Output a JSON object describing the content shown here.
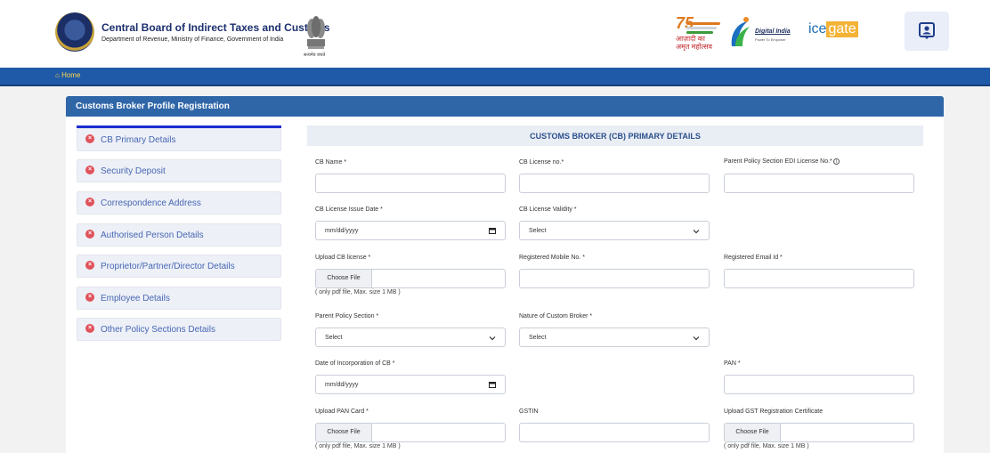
{
  "header": {
    "org_title": "Central Board of Indirect Taxes and Customs",
    "org_subtitle": "Department of Revenue, Ministry of Finance, Government of India",
    "emblem_caption": "सत्यमेव जयते",
    "azadi_number": "75",
    "azadi_hindi_1": "आज़ादी का",
    "azadi_hindi_2": "अमृत महोत्सव",
    "digital_india": "Digital India",
    "digital_india_tag": "Power To Empower",
    "icegate_left": "ice",
    "icegate_right": "gate"
  },
  "nav": {
    "home": "Home"
  },
  "panel": {
    "title": "Customs Broker Profile Registration"
  },
  "tabs": [
    {
      "label": "CB Primary Details"
    },
    {
      "label": "Security Deposit"
    },
    {
      "label": "Correspondence Address"
    },
    {
      "label": "Authorised Person Details"
    },
    {
      "label": "Proprietor/Partner/Director Details"
    },
    {
      "label": "Employee Details"
    },
    {
      "label": "Other Policy Sections Details"
    }
  ],
  "form": {
    "section_title": "CUSTOMS BROKER (CB) PRIMARY DETAILS",
    "cb_name": "CB Name *",
    "cb_license_no": "CB License no.*",
    "parent_edi": "Parent Policy Section EDI License No.*",
    "issue_date": "CB License Issue Date *",
    "license_validity": "CB License Validity *",
    "upload_cb_license": "Upload CB license *",
    "reg_mobile": "Registered Mobile No. *",
    "reg_email": "Registered Email Id *",
    "parent_policy": "Parent Policy Section *",
    "nature_cb": "Nature of Custom Broker *",
    "date_incorp": "Date of Incorporation of CB *",
    "pan": "PAN *",
    "upload_pan": "Upload PAN Card *",
    "gstin": "GSTIN",
    "upload_gst": "Upload GST Registration Certificate",
    "date_placeholder": "mm/dd/yyyy",
    "select_placeholder": "Select",
    "choose_file": "Choose File",
    "file_note": "( only pdf file, Max. size 1 MB )"
  }
}
